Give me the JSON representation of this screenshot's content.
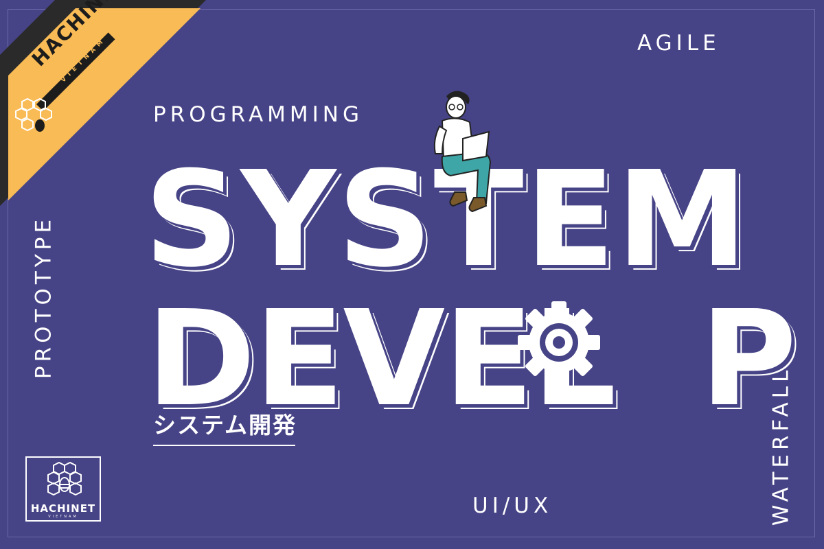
{
  "labels": {
    "agile": "AGILE",
    "programming": "PROGRAMMING",
    "prototype": "PROTOTYPE",
    "waterfall": "WATERFALL",
    "uiux": "UI/UX"
  },
  "headline": {
    "line1": "SYSTEM",
    "line2": "DEVEL",
    "line2_end": "P"
  },
  "subtitle_jp": "システム開発",
  "brand": {
    "name": "HACHINET",
    "sub": "VIETNAM"
  },
  "colors": {
    "background": "#464386",
    "ribbon": "#f9bb55",
    "ribbon_band": "#1c1c1c",
    "text": "#ffffff"
  },
  "icons": [
    "gear-icon",
    "person-with-laptop-icon",
    "honeycomb-bee-icon"
  ]
}
